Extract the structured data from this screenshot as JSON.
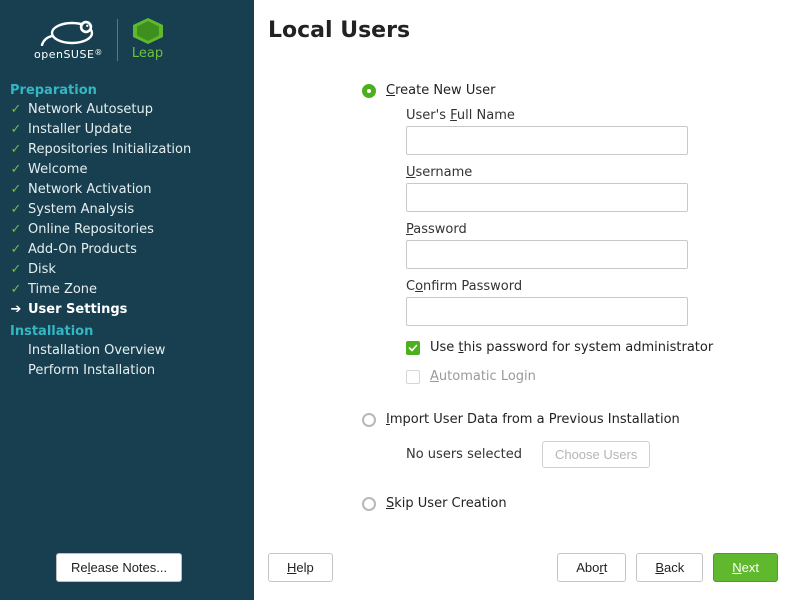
{
  "branding": {
    "distro": "openSUSE",
    "flavor": "Leap"
  },
  "sidebar": {
    "section_preparation": "Preparation",
    "section_installation": "Installation",
    "steps_preparation": [
      {
        "label": "Network Autosetup",
        "done": true
      },
      {
        "label": "Installer Update",
        "done": true
      },
      {
        "label": "Repositories Initialization",
        "done": true
      },
      {
        "label": "Welcome",
        "done": true
      },
      {
        "label": "Network Activation",
        "done": true
      },
      {
        "label": "System Analysis",
        "done": true
      },
      {
        "label": "Online Repositories",
        "done": true
      },
      {
        "label": "Add-On Products",
        "done": true
      },
      {
        "label": "Disk",
        "done": true
      },
      {
        "label": "Time Zone",
        "done": true
      },
      {
        "label": "User Settings",
        "current": true
      }
    ],
    "steps_installation": [
      {
        "label": "Installation Overview"
      },
      {
        "label": "Perform Installation"
      }
    ],
    "release_notes_label": "Release Notes..."
  },
  "page": {
    "title": "Local Users",
    "radios": {
      "create": "Create New User",
      "import": "Import User Data from a Previous Installation",
      "skip": "Skip User Creation",
      "selected": "create"
    },
    "fields": {
      "fullname_label": "User's Full Name",
      "fullname_value": "",
      "username_label": "Username",
      "username_value": "",
      "password_label": "Password",
      "password_value": "",
      "confirm_label": "Confirm Password",
      "confirm_value": ""
    },
    "checkboxes": {
      "use_for_root_label": "Use this password for system administrator",
      "use_for_root_checked": true,
      "autologin_label": "Automatic Login",
      "autologin_checked": false
    },
    "import": {
      "status": "No users selected",
      "choose_label": "Choose Users"
    }
  },
  "buttons": {
    "help": "Help",
    "abort": "Abort",
    "back": "Back",
    "next": "Next"
  }
}
